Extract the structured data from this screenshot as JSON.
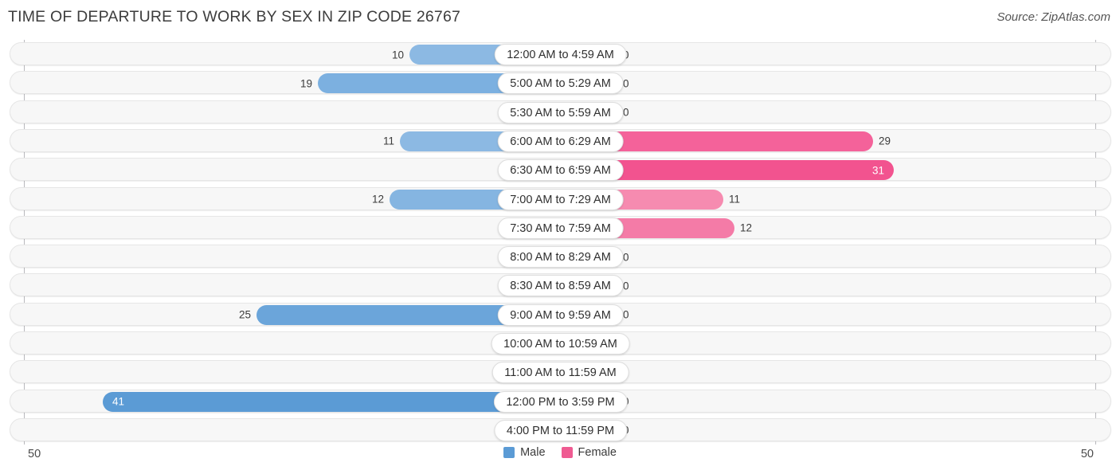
{
  "header": {
    "title": "TIME OF DEPARTURE TO WORK BY SEX IN ZIP CODE 26767",
    "source": "Source: ZipAtlas.com"
  },
  "legend": {
    "male_label": "Male",
    "female_label": "Female",
    "male_color": "#5b9bd5",
    "female_color": "#ef5b92"
  },
  "axis": {
    "left_max": "50",
    "right_max": "50"
  },
  "chart_data": {
    "type": "bar",
    "title": "TIME OF DEPARTURE TO WORK BY SEX IN ZIP CODE 26767",
    "orientation": "horizontal-diverging",
    "xlabel": "",
    "ylabel": "",
    "xlim": [
      50,
      50
    ],
    "grid": false,
    "legend_position": "bottom-center",
    "categories": [
      "12:00 AM to 4:59 AM",
      "5:00 AM to 5:29 AM",
      "5:30 AM to 5:59 AM",
      "6:00 AM to 6:29 AM",
      "6:30 AM to 6:59 AM",
      "7:00 AM to 7:29 AM",
      "7:30 AM to 7:59 AM",
      "8:00 AM to 8:29 AM",
      "8:30 AM to 8:59 AM",
      "9:00 AM to 9:59 AM",
      "10:00 AM to 10:59 AM",
      "11:00 AM to 11:59 AM",
      "12:00 PM to 3:59 PM",
      "4:00 PM to 11:59 PM"
    ],
    "series": [
      {
        "name": "Male",
        "values": [
          10,
          19,
          0,
          11,
          0,
          12,
          0,
          0,
          0,
          25,
          0,
          0,
          41,
          0
        ]
      },
      {
        "name": "Female",
        "values": [
          0,
          0,
          0,
          29,
          31,
          11,
          12,
          0,
          0,
          0,
          0,
          0,
          0,
          0
        ]
      }
    ]
  },
  "rows": [
    {
      "label": "12:00 AM to 4:59 AM",
      "male": "10",
      "female": "0",
      "male_w": 188,
      "female_w": 70,
      "male_color": "#8cb9e3",
      "female_color": "#f59cbc",
      "male_inside": false,
      "female_inside": false
    },
    {
      "label": "5:00 AM to 5:29 AM",
      "male": "19",
      "female": "0",
      "male_w": 303,
      "female_w": 70,
      "male_color": "#7cb0e0",
      "female_color": "#f59cbc",
      "male_inside": false,
      "female_inside": false
    },
    {
      "label": "5:30 AM to 5:59 AM",
      "male": "0",
      "female": "0",
      "male_w": 60,
      "female_w": 70,
      "male_color": "#a9caeb",
      "female_color": "#f7aec8",
      "male_inside": false,
      "female_inside": false
    },
    {
      "label": "6:00 AM to 6:29 AM",
      "male": "11",
      "female": "29",
      "male_w": 200,
      "female_w": 391,
      "male_color": "#8cb9e3",
      "female_color": "#f4629a",
      "male_inside": false,
      "female_inside": false
    },
    {
      "label": "6:30 AM to 6:59 AM",
      "male": "0",
      "female": "31",
      "male_w": 60,
      "female_w": 417,
      "male_color": "#a9caeb",
      "female_color": "#f2538f",
      "male_inside": false,
      "female_inside": true
    },
    {
      "label": "7:00 AM to 7:29 AM",
      "male": "12",
      "female": "11",
      "male_w": 213,
      "female_w": 203,
      "male_color": "#85b5e1",
      "female_color": "#f68bb0",
      "male_inside": false,
      "female_inside": false
    },
    {
      "label": "7:30 AM to 7:59 AM",
      "male": "0",
      "female": "12",
      "male_w": 60,
      "female_w": 217,
      "male_color": "#a9caeb",
      "female_color": "#f47ba7",
      "male_inside": false,
      "female_inside": false
    },
    {
      "label": "8:00 AM to 8:29 AM",
      "male": "0",
      "female": "0",
      "male_w": 60,
      "female_w": 70,
      "male_color": "#a9caeb",
      "female_color": "#f79ec0",
      "male_inside": false,
      "female_inside": false
    },
    {
      "label": "8:30 AM to 8:59 AM",
      "male": "0",
      "female": "0",
      "male_w": 60,
      "female_w": 70,
      "male_color": "#a9caeb",
      "female_color": "#f68fb4",
      "male_inside": false,
      "female_inside": false
    },
    {
      "label": "9:00 AM to 9:59 AM",
      "male": "25",
      "female": "0",
      "male_w": 380,
      "female_w": 70,
      "male_color": "#6ba5da",
      "female_color": "#f58cb2",
      "male_inside": false,
      "female_inside": false
    },
    {
      "label": "10:00 AM to 10:59 AM",
      "male": "0",
      "female": "0",
      "male_w": 60,
      "female_w": 70,
      "male_color": "#a9caeb",
      "female_color": "#f68fb4",
      "male_inside": false,
      "female_inside": false
    },
    {
      "label": "11:00 AM to 11:59 AM",
      "male": "0",
      "female": "0",
      "male_w": 60,
      "female_w": 70,
      "male_color": "#a9caeb",
      "female_color": "#f68fb4",
      "male_inside": false,
      "female_inside": false
    },
    {
      "label": "12:00 PM to 3:59 PM",
      "male": "41",
      "female": "0",
      "male_w": 573,
      "female_w": 70,
      "male_color": "#5b9bd5",
      "female_color": "#f58cb2",
      "male_inside": true,
      "female_inside": false
    },
    {
      "label": "4:00 PM to 11:59 PM",
      "male": "0",
      "female": "0",
      "male_w": 60,
      "female_w": 70,
      "male_color": "#a9caeb",
      "female_color": "#f68fb4",
      "male_inside": false,
      "female_inside": false
    }
  ]
}
